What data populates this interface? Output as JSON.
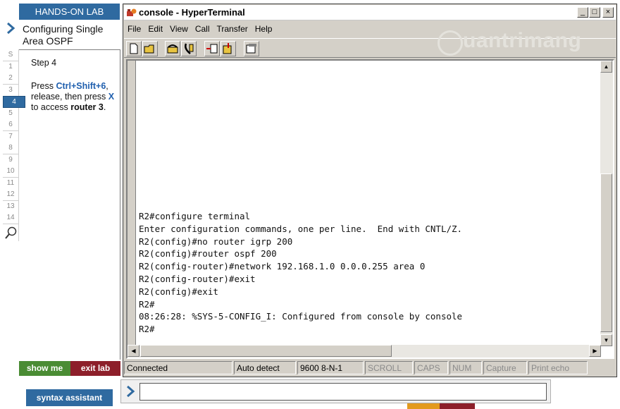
{
  "lab": {
    "header": "HANDS-ON LAB",
    "title": "Configuring Single Area OSPF",
    "steps": [
      "S",
      "1",
      "2",
      "3",
      "4",
      "5",
      "6",
      "7",
      "8",
      "9",
      "10",
      "11",
      "12",
      "13",
      "14"
    ],
    "active_step": "4",
    "step_label": "Step 4",
    "instr": {
      "t1": "Press ",
      "t2": "Ctrl+Shift+6",
      "t3": ", release, then press ",
      "t4": "X",
      "t5": " to access ",
      "t6": "router 3",
      "t7": "."
    },
    "show_me": "show me",
    "exit_lab": "exit lab",
    "syntax_assistant": "syntax assistant"
  },
  "window": {
    "title": "console - HyperTerminal",
    "controls": {
      "minimize": "_",
      "maximize": "□",
      "close": "×"
    },
    "menu": [
      "File",
      "Edit",
      "View",
      "Call",
      "Transfer",
      "Help"
    ],
    "watermark": "uantrimang"
  },
  "terminal": {
    "lines": [
      "R2#configure terminal",
      "Enter configuration commands, one per line.  End with CNTL/Z.",
      "R2(config)#no router igrp 200",
      "R2(config)#router ospf 200",
      "R2(config-router)#network 192.168.1.0 0.0.0.255 area 0",
      "R2(config-router)#exit",
      "R2(config)#exit",
      "R2#",
      "08:26:28: %SYS-5-CONFIG_I: Configured from console by console",
      "R2#"
    ]
  },
  "status": {
    "connected": "Connected",
    "detect": "Auto detect",
    "baud": "9600 8-N-1",
    "scroll": "SCROLL",
    "caps": "CAPS",
    "num": "NUM",
    "capture": "Capture",
    "echo": "Print echo"
  },
  "command": {
    "value": ""
  },
  "colors": {
    "lab_blue": "#2f6aa0",
    "show_green": "#4a8c34",
    "exit_red": "#8d1f2a",
    "highlight": "#1f5fae"
  }
}
